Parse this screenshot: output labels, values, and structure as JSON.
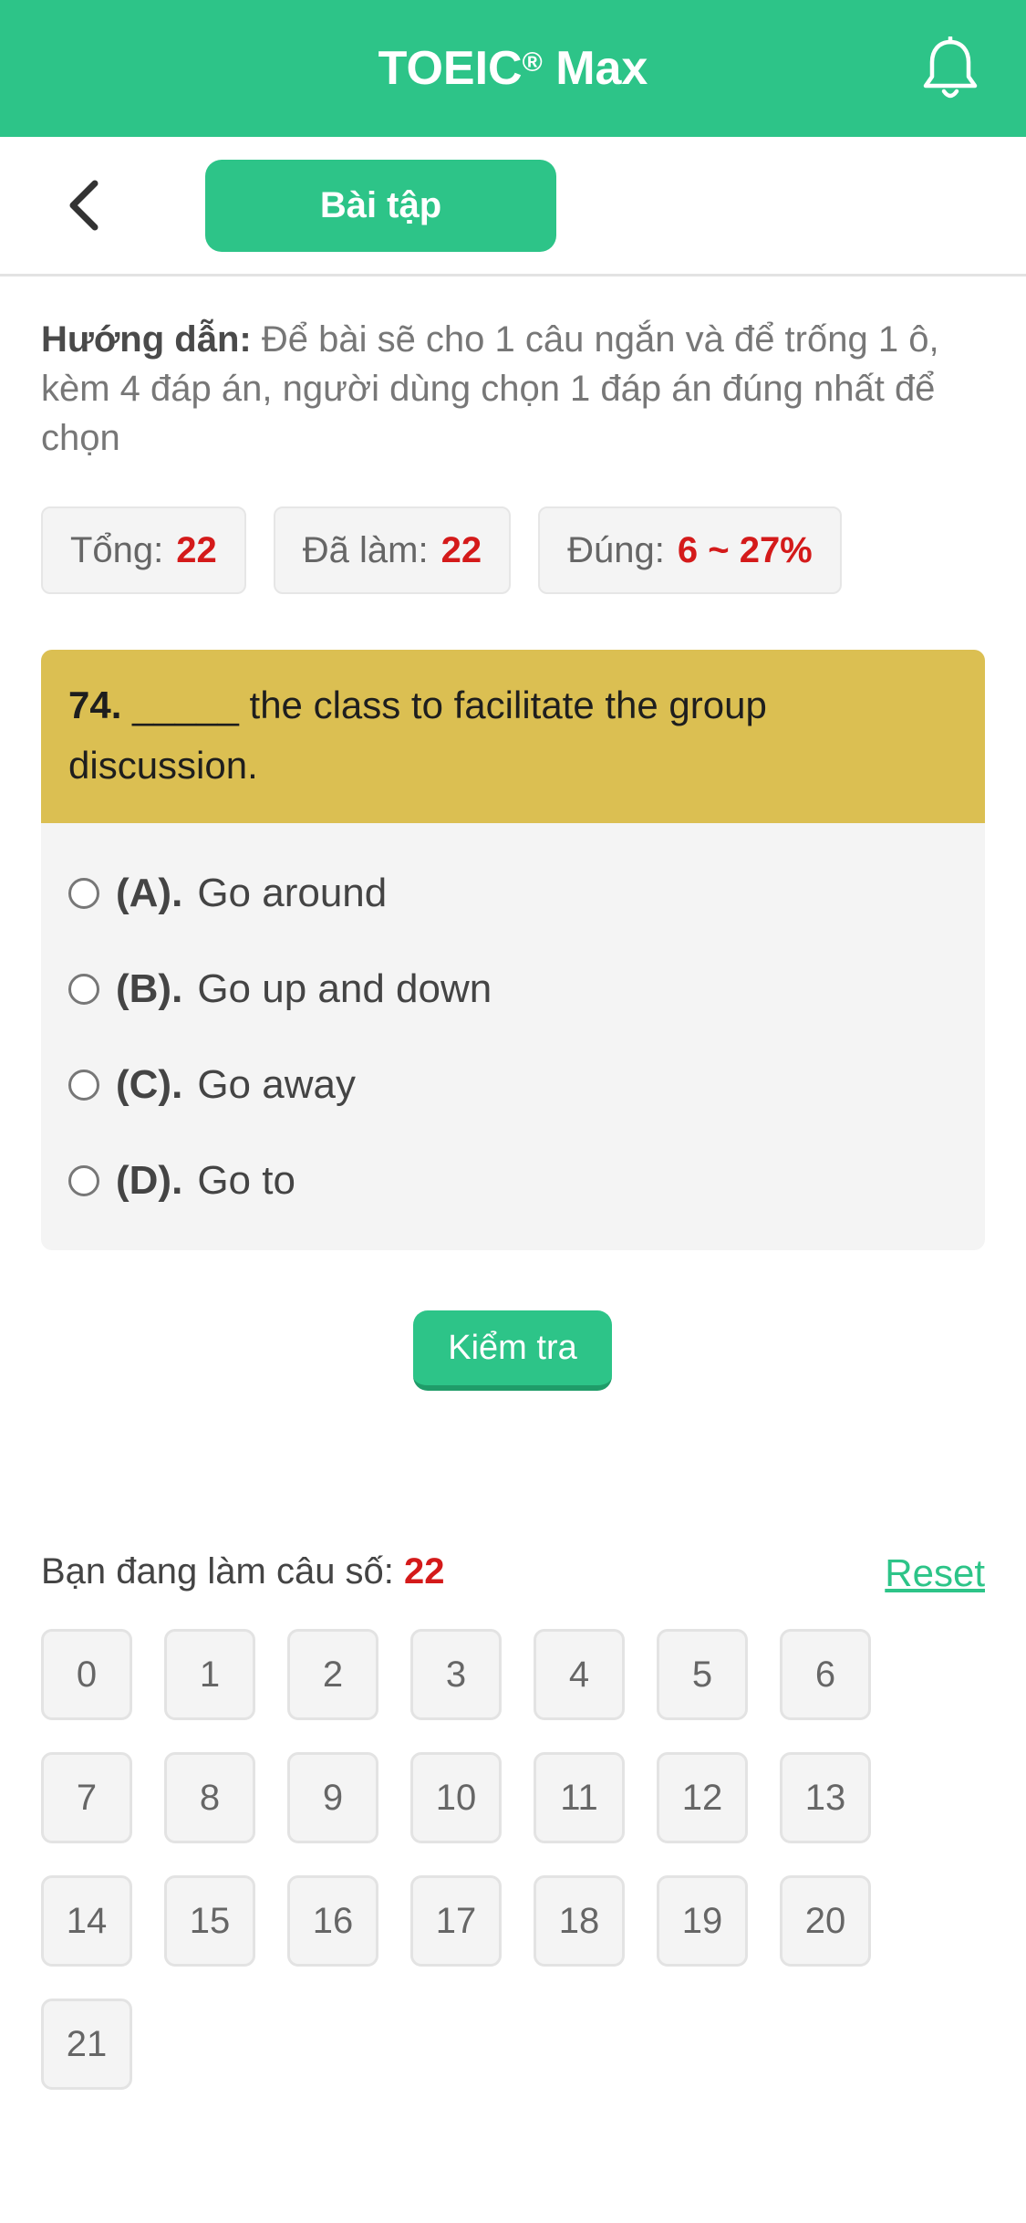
{
  "header": {
    "title": "TOEIC",
    "registered": "®",
    "title_suffix": "Max"
  },
  "subbar": {
    "tab_label": "Bài tập"
  },
  "instruction": {
    "label": "Hướng dẫn:",
    "text": "Để bài sẽ cho 1 câu ngắn và để trống 1 ô, kèm 4 đáp án, người dùng chọn 1 đáp án đúng nhất để chọn"
  },
  "stats": {
    "total_label": "Tổng:",
    "total_value": "22",
    "done_label": "Đã làm:",
    "done_value": "22",
    "correct_label": "Đúng:",
    "correct_value": "6 ~ 27%"
  },
  "question": {
    "number": "74.",
    "text": "_____ the class to facilitate the group discussion.",
    "options": [
      {
        "label": "(A).",
        "text": "Go around"
      },
      {
        "label": "(B).",
        "text": "Go up and down"
      },
      {
        "label": "(C).",
        "text": "Go away"
      },
      {
        "label": "(D).",
        "text": "Go to"
      }
    ]
  },
  "check_button": "Kiểm tra",
  "progress": {
    "label": "Bạn đang làm câu số:",
    "current": "22",
    "reset": "Reset"
  },
  "question_numbers": [
    "0",
    "1",
    "2",
    "3",
    "4",
    "5",
    "6",
    "7",
    "8",
    "9",
    "10",
    "11",
    "12",
    "13",
    "14",
    "15",
    "16",
    "17",
    "18",
    "19",
    "20",
    "21"
  ],
  "colors": {
    "brand": "#2dc488",
    "question_header": "#dbbf52",
    "highlight_red": "#d41a1a"
  }
}
